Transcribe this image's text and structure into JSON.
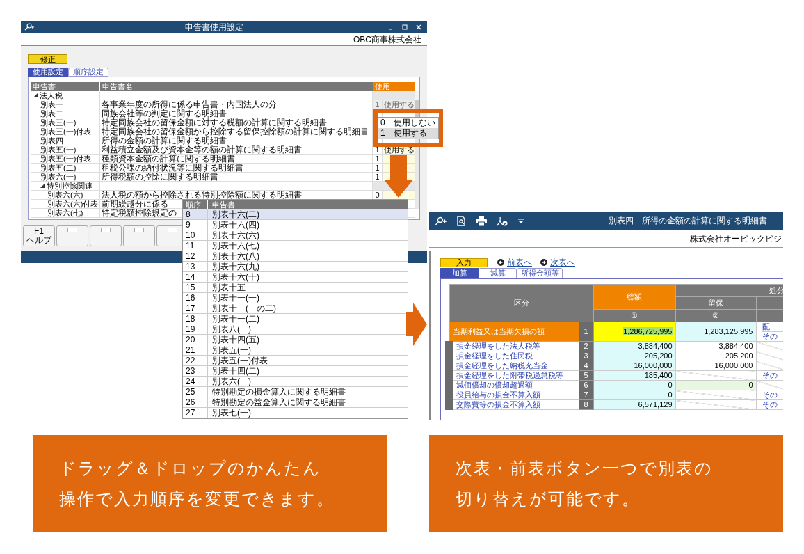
{
  "left_window": {
    "title": "申告書使用設定",
    "company": "OBC商事株式会社",
    "mode_button": "修正",
    "tabs": [
      {
        "label": "使用設定",
        "selected": true
      },
      {
        "label": "順序設定",
        "selected": false
      }
    ],
    "table": {
      "columns": [
        "申告書",
        "申告書名",
        "使用"
      ],
      "rows": [
        {
          "kind": "group",
          "label": "法人税",
          "expanded": true,
          "children": [
            {
              "kind": "form",
              "code": "別表一",
              "name": "各事業年度の所得に係る申告書・内国法人の分",
              "use_code": "1",
              "use_label": "使用する",
              "disabled": true
            },
            {
              "kind": "form",
              "code": "別表二",
              "name": "同族会社等の判定に関する明細書"
            },
            {
              "kind": "form",
              "code": "別表三(一)",
              "name": "特定同族会社の留保金額に対する税額の計算に関する明細書"
            },
            {
              "kind": "form",
              "code": "別表三(一)付表",
              "name": "特定同族会社の留保金額から控除する留保控除額の計算に関する明細書"
            },
            {
              "kind": "form",
              "code": "別表四",
              "name": "所得の金額の計算に関する明細書"
            },
            {
              "kind": "form",
              "code": "別表五(一)",
              "name": "利益積立金額及び資本金等の額の計算に関する明細書",
              "use_code": "1",
              "use_label": "使用する",
              "disabled": false
            },
            {
              "kind": "form",
              "code": "別表五(一)付表",
              "name": "種類資本金額の計算に関する明細書",
              "use_code": "1",
              "disabled": false
            },
            {
              "kind": "form",
              "code": "別表五(二)",
              "name": "租税公課の納付状況等に関する明細書",
              "use_code": "1",
              "disabled": false
            },
            {
              "kind": "form",
              "code": "別表六(一)",
              "name": "所得税額の控除に関する明細書",
              "use_code": "1",
              "disabled": false
            },
            {
              "kind": "group",
              "label": "特別控除関連",
              "expanded": true,
              "children": [
                {
                  "kind": "form",
                  "code": "別表六(六)",
                  "name": "法人税の額から控除される特別控除額に関する明細書",
                  "use_code": "0",
                  "disabled": false
                },
                {
                  "kind": "form",
                  "code": "別表六(六)付表",
                  "name": "前期繰越分に係る"
                },
                {
                  "kind": "form",
                  "code": "別表六(七)",
                  "name": "特定税額控除規定の"
                }
              ]
            }
          ]
        }
      ]
    },
    "dropdown": {
      "options": [
        {
          "code": "0",
          "label": "使用しない",
          "selected": false
        },
        {
          "code": "1",
          "label": "使用する",
          "selected": true
        }
      ]
    },
    "function_keys": [
      {
        "kind": "labeled",
        "key": "F1",
        "label": "ヘルプ"
      },
      {
        "kind": "blank"
      },
      {
        "kind": "blank"
      },
      {
        "kind": "blank"
      },
      {
        "kind": "blank"
      }
    ]
  },
  "order_popup": {
    "columns": [
      "順序",
      "申告書"
    ],
    "rows": [
      {
        "order": "8",
        "name": "別表十六(二)",
        "selected": true
      },
      {
        "order": "9",
        "name": "別表十六(四)",
        "selected": false
      },
      {
        "order": "10",
        "name": "別表十六(六)",
        "selected": false
      },
      {
        "order": "11",
        "name": "別表十六(七)",
        "selected": false
      },
      {
        "order": "12",
        "name": "別表十六(八)",
        "selected": false
      },
      {
        "order": "13",
        "name": "別表十六(九)",
        "selected": false
      },
      {
        "order": "14",
        "name": "別表十六(十)",
        "selected": false
      },
      {
        "order": "15",
        "name": "別表十五",
        "selected": false
      },
      {
        "order": "16",
        "name": "別表十一(一)",
        "selected": false
      },
      {
        "order": "17",
        "name": "別表十一(一の二)",
        "selected": false
      },
      {
        "order": "18",
        "name": "別表十一(二)",
        "selected": false
      },
      {
        "order": "19",
        "name": "別表八(一)",
        "selected": false
      },
      {
        "order": "20",
        "name": "別表十四(五)",
        "selected": false
      },
      {
        "order": "21",
        "name": "別表五(一)",
        "selected": false
      },
      {
        "order": "22",
        "name": "別表五(一)付表",
        "selected": false
      },
      {
        "order": "23",
        "name": "別表十四(二)",
        "selected": false
      },
      {
        "order": "24",
        "name": "別表六(一)",
        "selected": false
      },
      {
        "order": "25",
        "name": "特別勘定の損金算入に関する明細書",
        "selected": false
      },
      {
        "order": "26",
        "name": "特別勘定の益金算入に関する明細書",
        "selected": false
      },
      {
        "order": "27",
        "name": "別表七(一)",
        "selected": false
      }
    ]
  },
  "right_window": {
    "title": "別表四　所得の金額の計算に関する明細書",
    "company": "株式会社オービックビジ",
    "mode_button": "入力",
    "nav": [
      {
        "label": "前表へ",
        "kind": "prev"
      },
      {
        "label": "次表へ",
        "kind": "next"
      }
    ],
    "tabs": [
      {
        "label": "加算",
        "selected": true
      },
      {
        "label": "減算",
        "selected": false
      },
      {
        "label": "所得金額等",
        "selected": false
      }
    ],
    "table": {
      "header": {
        "category": "区分",
        "total": "総額",
        "disposal": "処分",
        "retained": "留保",
        "total_mark": "①",
        "retained_mark": "②"
      },
      "rows": [
        {
          "kind": "main",
          "no": "1",
          "label": "当期利益又は当期欠損の額",
          "total": "1,286,725,995",
          "retained": "1,283,125,995",
          "retained_editable": false,
          "disposal_lines": [
            "配",
            "その"
          ],
          "selected": true
        },
        {
          "kind": "item",
          "no": "2",
          "label": "損金経理をした法人税等",
          "total": "3,884,400",
          "retained": "3,884,400",
          "retained_editable": false,
          "selected": false
        },
        {
          "kind": "item",
          "no": "3",
          "label": "損金経理をした住民税",
          "total": "205,200",
          "retained": "205,200",
          "retained_editable": false,
          "selected": false
        },
        {
          "kind": "item",
          "no": "4",
          "label": "損金経理をした納税充当金",
          "total": "16,000,000",
          "retained": "16,000,000",
          "retained_editable": false,
          "selected": false
        },
        {
          "kind": "item",
          "no": "5",
          "label": "損金経理をした附帯税過怠税等",
          "total": "185,400",
          "disposal_lines": [
            "その"
          ],
          "selected": false
        },
        {
          "kind": "item",
          "no": "6",
          "label": "減価償却の償却超過額",
          "total": "0",
          "retained": "0",
          "retained_editable": true,
          "selected": false
        },
        {
          "kind": "item",
          "no": "7",
          "label": "役員給与の損金不算入額",
          "total": "0",
          "disposal_lines": [
            "その"
          ],
          "selected": false
        },
        {
          "kind": "item",
          "no": "8",
          "label": "交際費等の損金不算入額",
          "total": "6,571,129",
          "disposal_lines": [
            "その"
          ],
          "selected": false
        }
      ]
    }
  },
  "captions": [
    {
      "lines": [
        "ドラッグ＆ドロップのかんたん",
        "操作で入力順序を変更できます。"
      ]
    },
    {
      "lines": [
        "次表・前表ボタン一つで別表の",
        "切り替えが可能です。"
      ]
    }
  ]
}
